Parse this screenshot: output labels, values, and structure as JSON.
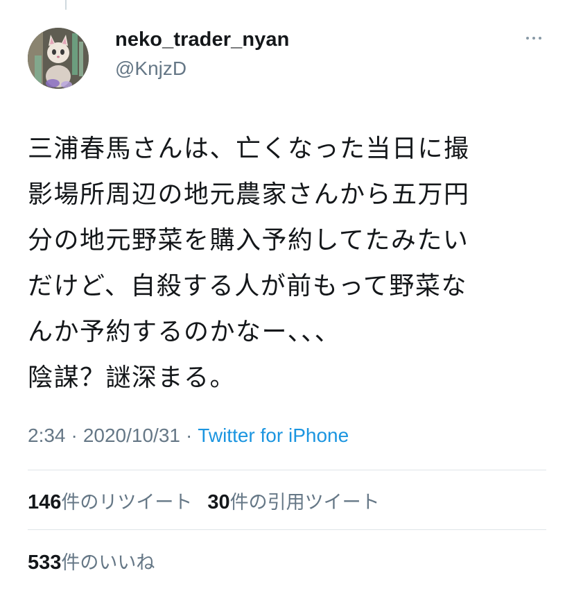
{
  "user": {
    "display_name": "neko_trader_nyan",
    "handle": "@KnjzD",
    "avatar_icon": "cat-figurine-avatar"
  },
  "tweet": {
    "text": "三浦春馬さんは、亡くなった当日に撮\n影場所周辺の地元農家さんから五万円\n分の地元野菜を購入予約してたみたい\nだけど、自殺する人が前もって野菜な\nんか予約するのかなー、、、\n陰謀？謎深まる。"
  },
  "meta": {
    "time": "2:34",
    "separator": "·",
    "date": "2020/10/31",
    "source": "Twitter for iPhone"
  },
  "stats": {
    "retweets_count": "146",
    "retweets_label": "件のリツイート",
    "quotes_count": "30",
    "quotes_label": "件の引用ツイート",
    "likes_count": "533",
    "likes_label": "件のいいね"
  },
  "colors": {
    "text": "#14171a",
    "secondary": "#657786",
    "link": "#1b95e0",
    "divider": "#dfe4e8"
  }
}
